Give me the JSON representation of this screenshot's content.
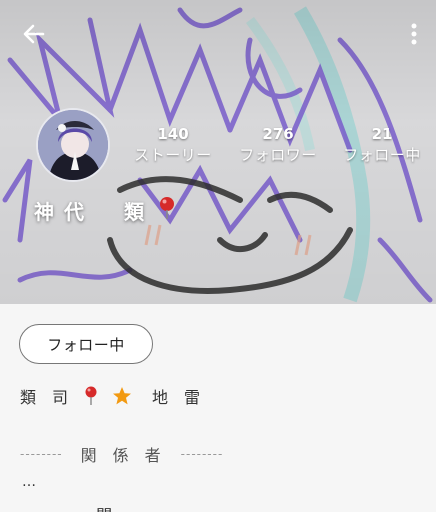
{
  "profile": {
    "display_name": "神代　類",
    "stats": [
      {
        "value": "140",
        "label": "ストーリー"
      },
      {
        "value": "276",
        "label": "フォロワー"
      },
      {
        "value": "21",
        "label": "フォロー中"
      }
    ],
    "follow_button_label": "フォロー中"
  },
  "bio": {
    "line1_text_a": "類司",
    "line1_text_b": "地雷",
    "section_dash": "--------",
    "section_title": "関係者",
    "ellipsis": "…",
    "cut_off_text": "ー ー 間"
  },
  "colors": {
    "purple_scribble": "#7b5fcf",
    "cyan_scribble": "#7fd0cf",
    "pin_red": "#d62a2a",
    "star_orange": "#f29a12"
  },
  "icons": {
    "back": "arrow-left-icon",
    "more": "more-vertical-icon",
    "pin": "red-pin-icon",
    "star": "star-icon"
  }
}
